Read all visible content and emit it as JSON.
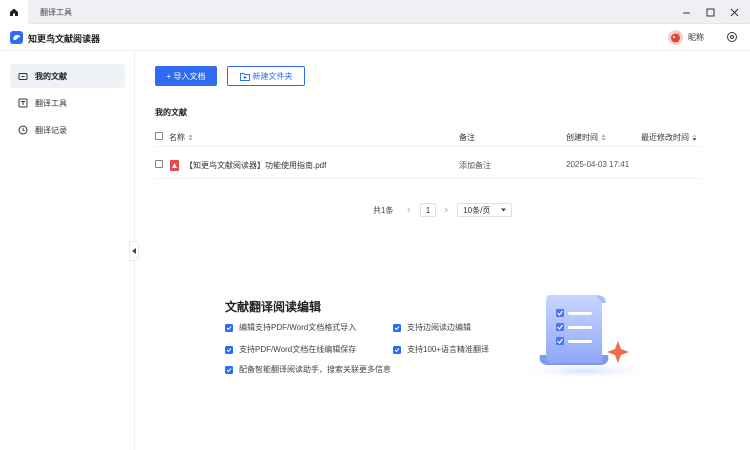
{
  "tabbar": {
    "tab_label": "翻译工具"
  },
  "app": {
    "title": "知更鸟文献阅读器",
    "user_nickname": "昵称"
  },
  "sidebar": {
    "items": [
      {
        "label": "我的文献",
        "icon": "folder-icon",
        "active": true
      },
      {
        "label": "翻译工具",
        "icon": "translate-icon",
        "active": false
      },
      {
        "label": "翻译记录",
        "icon": "clock-icon",
        "active": false
      }
    ]
  },
  "toolbar": {
    "import_label": "+ 导入文档",
    "new_folder_label": "新建文件夹"
  },
  "section": {
    "title": "我的文献"
  },
  "table": {
    "columns": {
      "name": "名称",
      "note": "备注",
      "created": "创建时间",
      "modified": "最近修改时间"
    },
    "rows": [
      {
        "name": "【知更鸟文献阅读器】功能使用指南.pdf",
        "note": "添加备注",
        "created": "2025-04-03 17:41",
        "modified": ""
      }
    ]
  },
  "pagination": {
    "total": "共1条",
    "page": "1",
    "page_size": "10条/页"
  },
  "promo": {
    "title": "文献翻译阅读编辑",
    "features": [
      "编辑支持PDF/Word文档格式导入",
      "支持边阅读边编辑",
      "支持PDF/Word文档在线编辑保存",
      "支持100+语言精准翻译",
      "配备智能翻译阅读助手，搜索关联更多信息"
    ]
  },
  "colors": {
    "accent": "#2f6bf5",
    "pdf_red": "#e5484d",
    "active_bg": "#eef1f6"
  }
}
